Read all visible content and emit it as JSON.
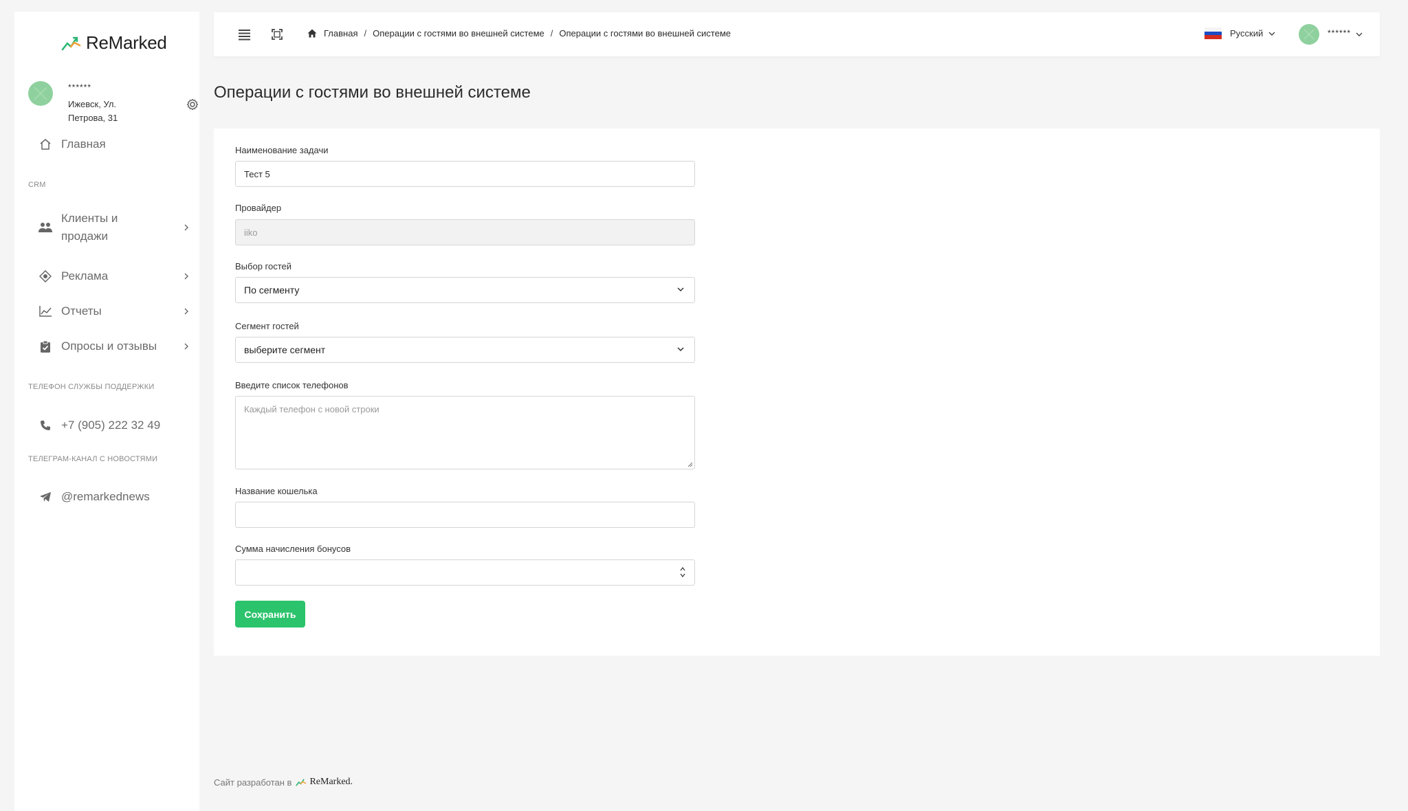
{
  "app": {
    "logo_text": "ReMarked"
  },
  "sidebar": {
    "profile_name": "******",
    "profile_address": "Ижевск, Ул. Петрова, 31",
    "nav": [
      {
        "label": "Главная"
      },
      {
        "label": "Клиенты и продажи"
      },
      {
        "label": "Реклама"
      },
      {
        "label": "Отчеты"
      },
      {
        "label": "Опросы и отзывы"
      }
    ],
    "section_crm": "CRM",
    "section_support": "ТЕЛЕФОН СЛУЖБЫ ПОДДЕРЖКИ",
    "support_phone": "+7 (905) 222 32 49",
    "section_telegram": "ТЕЛЕГРАМ-КАНАЛ С НОВОСТЯМИ",
    "telegram_handle": "@remarkednews"
  },
  "header": {
    "breadcrumb": [
      "Главная",
      "Операции с гостями во внешней системе",
      "Операции с гостями во внешней системе"
    ],
    "language": "Русский",
    "user_name": "******"
  },
  "main": {
    "title": "Операции с гостями во внешней системе",
    "form": {
      "task_name_label": "Наименование задачи",
      "task_name_value": "Тест 5",
      "provider_label": "Провайдер",
      "provider_value": "iiko",
      "guest_select_label": "Выбор гостей",
      "guest_select_value": "По сегменту",
      "segment_label": "Сегмент гостей",
      "segment_value": "выберите сегмент",
      "phones_label": "Введите список телефонов",
      "phones_placeholder": "Каждый телефон с новой строки",
      "wallet_label": "Название кошелька",
      "wallet_value": "",
      "bonus_label": "Сумма начисления бонусов",
      "bonus_value": "",
      "save_label": "Сохранить"
    }
  },
  "footer": {
    "text": "Сайт разработан в",
    "brand": "ReMarked."
  },
  "colors": {
    "accent_green": "#2bc36c",
    "avatar_green": "#8fd19e",
    "logo_orange": "#f0a13a",
    "logo_green": "#2bb673"
  }
}
